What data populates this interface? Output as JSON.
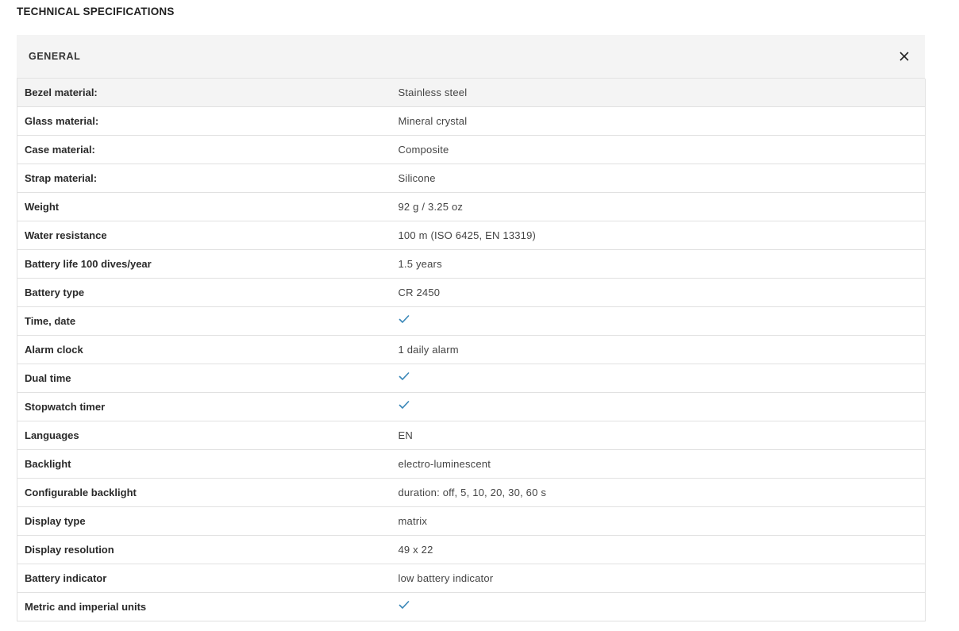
{
  "section_title": "TECHNICAL SPECIFICATIONS",
  "panel": {
    "title": "GENERAL",
    "close_icon": "close-icon"
  },
  "colors": {
    "check": "#3a87b8",
    "header_bg": "#f4f4f4",
    "border": "#e1e1e1"
  },
  "specs": [
    {
      "label": "Bezel material:",
      "value": "Stainless steel"
    },
    {
      "label": "Glass material:",
      "value": "Mineral crystal"
    },
    {
      "label": "Case material:",
      "value": "Composite"
    },
    {
      "label": "Strap material:",
      "value": "Silicone"
    },
    {
      "label": "Weight",
      "value": "92 g / 3.25 oz"
    },
    {
      "label": "Water resistance",
      "value": "100 m (ISO 6425, EN 13319)"
    },
    {
      "label": "Battery life 100 dives/year",
      "value": "1.5 years"
    },
    {
      "label": "Battery type",
      "value": "CR 2450"
    },
    {
      "label": "Time, date",
      "value": "",
      "check": true
    },
    {
      "label": "Alarm clock",
      "value": "1 daily alarm"
    },
    {
      "label": "Dual time",
      "value": "",
      "check": true
    },
    {
      "label": "Stopwatch timer",
      "value": "",
      "check": true
    },
    {
      "label": "Languages",
      "value": "EN"
    },
    {
      "label": "Backlight",
      "value": "electro-luminescent"
    },
    {
      "label": "Configurable backlight",
      "value": "duration: off, 5, 10, 20, 30, 60 s"
    },
    {
      "label": "Display type",
      "value": "matrix"
    },
    {
      "label": "Display resolution",
      "value": "49 x 22"
    },
    {
      "label": "Battery indicator",
      "value": "low battery indicator"
    },
    {
      "label": "Metric and imperial units",
      "value": "",
      "check": true
    }
  ]
}
